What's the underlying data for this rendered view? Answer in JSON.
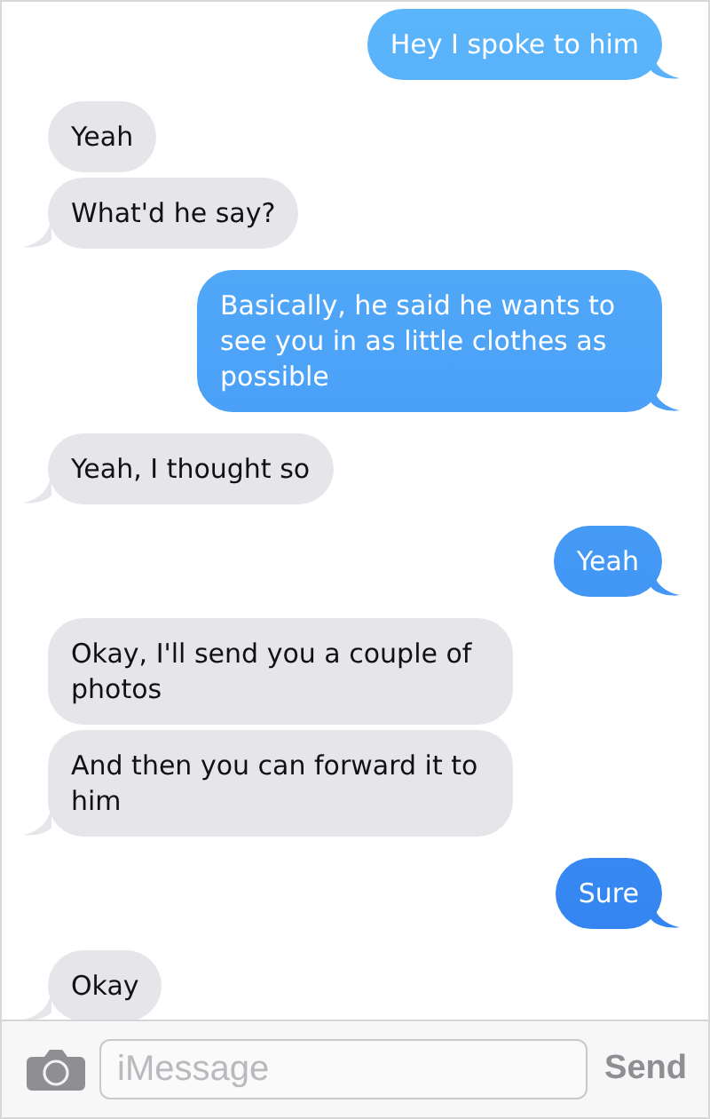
{
  "messages": [
    {
      "kind": "sent",
      "text": "Hey I spoke to him",
      "tail": true
    },
    {
      "kind": "received",
      "text": "Yeah",
      "tail": false
    },
    {
      "kind": "received",
      "text": "What'd he say?",
      "tail": true
    },
    {
      "kind": "sent",
      "text": "Basically, he said he wants to see you in as little clothes as possible",
      "tail": true
    },
    {
      "kind": "received",
      "text": "Yeah, I thought so",
      "tail": true
    },
    {
      "kind": "sent",
      "text": "Yeah",
      "tail": true
    },
    {
      "kind": "received",
      "text": "Okay, I'll send you a couple of photos",
      "tail": false
    },
    {
      "kind": "received",
      "text": "And then you can forward it to him",
      "tail": true
    },
    {
      "kind": "sent",
      "text": "Sure",
      "tail": true
    },
    {
      "kind": "received",
      "text": "Okay",
      "tail": true
    }
  ],
  "composer": {
    "placeholder": "iMessage",
    "send": "Send"
  }
}
